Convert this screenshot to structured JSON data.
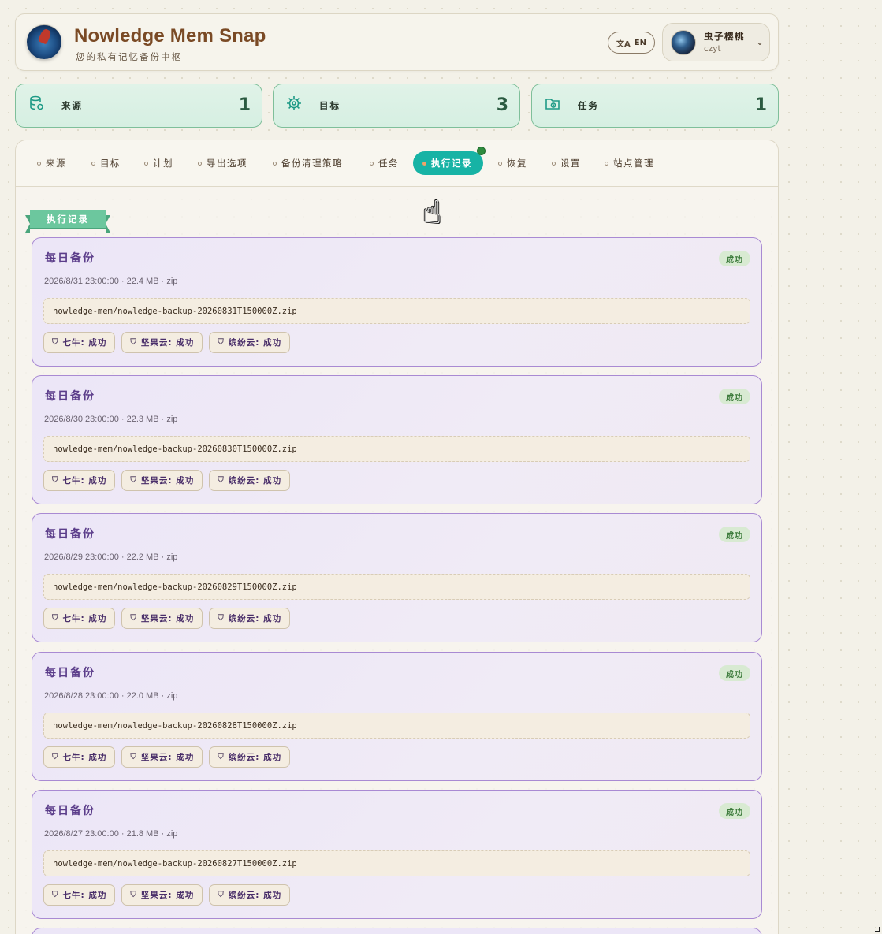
{
  "header": {
    "title": "Nowledge Mem Snap",
    "subtitle": "您的私有记忆备份中枢",
    "lang_label": "EN",
    "user_name": "虫子樱桃",
    "user_id": "czyt"
  },
  "stats": [
    {
      "label": "来源",
      "value": "1",
      "icon": "database-icon"
    },
    {
      "label": "目标",
      "value": "3",
      "icon": "helm-icon"
    },
    {
      "label": "任务",
      "value": "1",
      "icon": "folder-clock-icon"
    }
  ],
  "tabs": [
    {
      "label": "来源",
      "active": false
    },
    {
      "label": "目标",
      "active": false
    },
    {
      "label": "计划",
      "active": false
    },
    {
      "label": "导出选项",
      "active": false
    },
    {
      "label": "备份清理策略",
      "active": false
    },
    {
      "label": "任务",
      "active": false
    },
    {
      "label": "执行记录",
      "active": true
    },
    {
      "label": "恢复",
      "active": false
    },
    {
      "label": "设置",
      "active": false
    },
    {
      "label": "站点管理",
      "active": false
    }
  ],
  "section_title": "执行记录",
  "records": [
    {
      "title": "每日备份",
      "status": "成功",
      "meta": "2026/8/31 23:00:00 · 22.4 MB · zip",
      "path": "nowledge-mem/nowledge-backup-20260831T150000Z.zip",
      "targets": [
        "七牛: 成功",
        "坚果云: 成功",
        "缤纷云: 成功"
      ]
    },
    {
      "title": "每日备份",
      "status": "成功",
      "meta": "2026/8/30 23:00:00 · 22.3 MB · zip",
      "path": "nowledge-mem/nowledge-backup-20260830T150000Z.zip",
      "targets": [
        "七牛: 成功",
        "坚果云: 成功",
        "缤纷云: 成功"
      ]
    },
    {
      "title": "每日备份",
      "status": "成功",
      "meta": "2026/8/29 23:00:00 · 22.2 MB · zip",
      "path": "nowledge-mem/nowledge-backup-20260829T150000Z.zip",
      "targets": [
        "七牛: 成功",
        "坚果云: 成功",
        "缤纷云: 成功"
      ]
    },
    {
      "title": "每日备份",
      "status": "成功",
      "meta": "2026/8/28 23:00:00 · 22.0 MB · zip",
      "path": "nowledge-mem/nowledge-backup-20260828T150000Z.zip",
      "targets": [
        "七牛: 成功",
        "坚果云: 成功",
        "缤纷云: 成功"
      ]
    },
    {
      "title": "每日备份",
      "status": "成功",
      "meta": "2026/8/27 23:00:00 · 21.8 MB · zip",
      "path": "nowledge-mem/nowledge-backup-20260827T150000Z.zip",
      "targets": [
        "七牛: 成功",
        "坚果云: 成功",
        "缤纷云: 成功"
      ]
    }
  ]
}
